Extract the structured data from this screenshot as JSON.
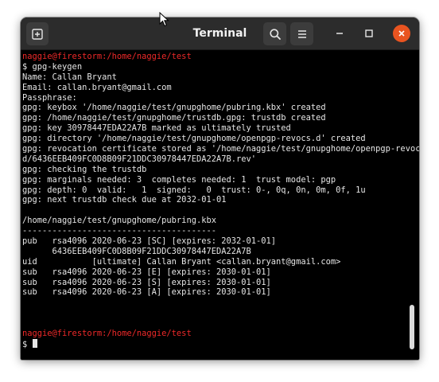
{
  "window": {
    "title": "Terminal"
  },
  "terminal": {
    "lines": [
      {
        "type": "prompt",
        "text": "naggie@firestorm:/home/naggie/test"
      },
      {
        "type": "command",
        "text": "$ gpg-keygen"
      },
      {
        "type": "output",
        "text": "Name: Callan Bryant"
      },
      {
        "type": "output",
        "text": "Email: callan.bryant@gmail.com"
      },
      {
        "type": "output",
        "text": "Passphrase:"
      },
      {
        "type": "output",
        "text": "gpg: keybox '/home/naggie/test/gnupghome/pubring.kbx' created"
      },
      {
        "type": "output",
        "text": "gpg: /home/naggie/test/gnupghome/trustdb.gpg: trustdb created"
      },
      {
        "type": "output",
        "text": "gpg: key 30978447EDA22A7B marked as ultimately trusted"
      },
      {
        "type": "output",
        "text": "gpg: directory '/home/naggie/test/gnupghome/openpgp-revocs.d' created"
      },
      {
        "type": "output",
        "text": "gpg: revocation certificate stored as '/home/naggie/test/gnupghome/openpgp-revocs."
      },
      {
        "type": "output",
        "text": "d/6436EEB409FC0D8B09F21DDC30978447EDA22A7B.rev'"
      },
      {
        "type": "output",
        "text": "gpg: checking the trustdb"
      },
      {
        "type": "output",
        "text": "gpg: marginals needed: 3  completes needed: 1  trust model: pgp"
      },
      {
        "type": "output",
        "text": "gpg: depth: 0  valid:   1  signed:   0  trust: 0-, 0q, 0n, 0m, 0f, 1u"
      },
      {
        "type": "output",
        "text": "gpg: next trustdb check due at 2032-01-01"
      },
      {
        "type": "output",
        "text": ""
      },
      {
        "type": "output",
        "text": "/home/naggie/test/gnupghome/pubring.kbx"
      },
      {
        "type": "output",
        "text": "---------------------------------------"
      },
      {
        "type": "output",
        "text": "pub   rsa4096 2020-06-23 [SC] [expires: 2032-01-01]"
      },
      {
        "type": "output",
        "text": "      6436EEB409FC0D8B09F21DDC30978447EDA22A7B"
      },
      {
        "type": "output",
        "text": "uid           [ultimate] Callan Bryant <callan.bryant@gmail.com>"
      },
      {
        "type": "output",
        "text": "sub   rsa4096 2020-06-23 [E] [expires: 2030-01-01]"
      },
      {
        "type": "output",
        "text": "sub   rsa4096 2020-06-23 [S] [expires: 2030-01-01]"
      },
      {
        "type": "output",
        "text": "sub   rsa4096 2020-06-23 [A] [expires: 2030-01-01]"
      },
      {
        "type": "output",
        "text": ""
      },
      {
        "type": "output",
        "text": ""
      },
      {
        "type": "output",
        "text": ""
      },
      {
        "type": "prompt",
        "text": "naggie@firestorm:/home/naggie/test"
      },
      {
        "type": "cursor",
        "text": "$ "
      }
    ]
  },
  "colors": {
    "prompt": "#ef2929",
    "close_button": "#e95420",
    "titlebar": "#2c2c2c",
    "terminal_bg": "#000000"
  },
  "icons": {
    "new_tab": "new-tab-icon",
    "search": "search-icon",
    "menu": "hamburger-menu-icon",
    "minimize": "minimize-icon",
    "maximize": "maximize-icon",
    "close": "close-icon"
  }
}
